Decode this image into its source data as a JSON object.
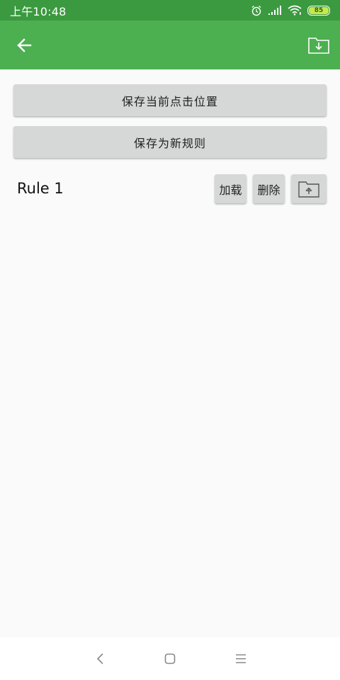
{
  "status_bar": {
    "time": "上午10:48",
    "battery_level": "85",
    "icons": [
      "alarm-icon",
      "signal-icon",
      "wifi-icon",
      "battery-icon"
    ]
  },
  "app_bar": {
    "back_icon": "arrow-left-icon",
    "import_icon": "folder-download-icon",
    "color": "#4caf50"
  },
  "actions": {
    "save_click_position": "保存当前点击位置",
    "save_new_rule": "保存为新规则"
  },
  "rules": [
    {
      "name": "Rule 1",
      "load_label": "加载",
      "delete_label": "删除",
      "export_icon": "folder-upload-icon"
    }
  ],
  "nav_bar": {
    "icons": [
      "nav-back-icon",
      "nav-home-icon",
      "nav-menu-icon"
    ]
  },
  "colors": {
    "status_bar": "#3b9a3f",
    "app_bar": "#4caf50",
    "button": "#d6d7d7",
    "background": "#fafafa"
  }
}
